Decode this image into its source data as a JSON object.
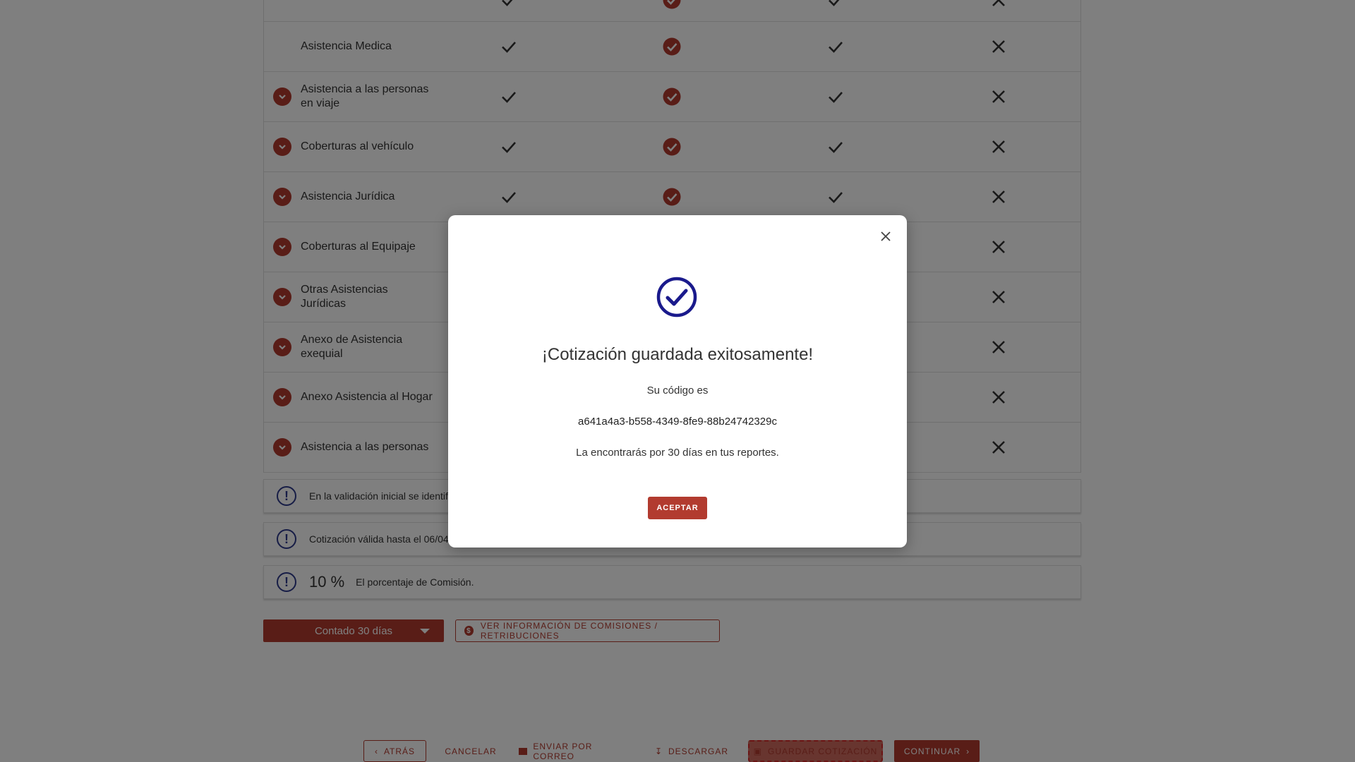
{
  "coverage_rows": [
    {
      "label": "",
      "has_expand": false,
      "cells": [
        "check",
        "check-circle",
        "check",
        "cross"
      ]
    },
    {
      "label": "Asistencia Medica",
      "has_expand": false,
      "cells": [
        "check",
        "check-circle",
        "check",
        "cross"
      ]
    },
    {
      "label": "Asistencia a las personas en viaje",
      "has_expand": true,
      "cells": [
        "check",
        "check-circle",
        "check",
        "cross"
      ]
    },
    {
      "label": "Coberturas al vehículo",
      "has_expand": true,
      "cells": [
        "check",
        "check-circle",
        "check",
        "cross"
      ]
    },
    {
      "label": "Asistencia Jurídica",
      "has_expand": true,
      "cells": [
        "check",
        "check-circle",
        "check",
        "cross"
      ]
    },
    {
      "label": "Coberturas al Equipaje",
      "has_expand": true,
      "cells": [
        "",
        "",
        "",
        "cross"
      ]
    },
    {
      "label": "Otras Asistencias Jurídicas",
      "has_expand": true,
      "cells": [
        "",
        "",
        "",
        "cross"
      ]
    },
    {
      "label": "Anexo de Asistencia exequial",
      "has_expand": true,
      "cells": [
        "",
        "",
        "",
        "cross"
      ]
    },
    {
      "label": "Anexo Asistencia al Hogar",
      "has_expand": true,
      "cells": [
        "",
        "",
        "",
        "cross"
      ]
    },
    {
      "label": "Asistencia a las personas",
      "has_expand": true,
      "cells": [
        "",
        "",
        "",
        "cross"
      ]
    }
  ],
  "banners": {
    "validation": "En la validación inicial se identifica",
    "validity": "Cotización válida hasta el 06/04/20",
    "commission_pct": "10 %",
    "commission_text": "El porcentaje de Comisión."
  },
  "payment": {
    "selected": "Contado 30 días"
  },
  "commission_button": "VER INFORMACIÓN DE COMISIONES / RETRIBUCIONES",
  "footer": {
    "back": "ATRÁS",
    "cancel": "CANCELAR",
    "email": "ENVIAR POR CORREO",
    "download": "DESCARGAR",
    "save": "GUARDAR COTIZACIÓN",
    "continue": "CONTINUAR"
  },
  "modal": {
    "title": "¡Cotización guardada exitosamente!",
    "code_label": "Su código es",
    "code": "a641a4a3-b558-4349-8fe9-88b24742329c",
    "note": "La encontrarás por 30 días en tus reportes.",
    "accept": "ACEPTAR"
  },
  "colors": {
    "brand": "#b23b2f",
    "icon_blue": "#1a1a8c",
    "info_blue": "#2e3a8c"
  }
}
